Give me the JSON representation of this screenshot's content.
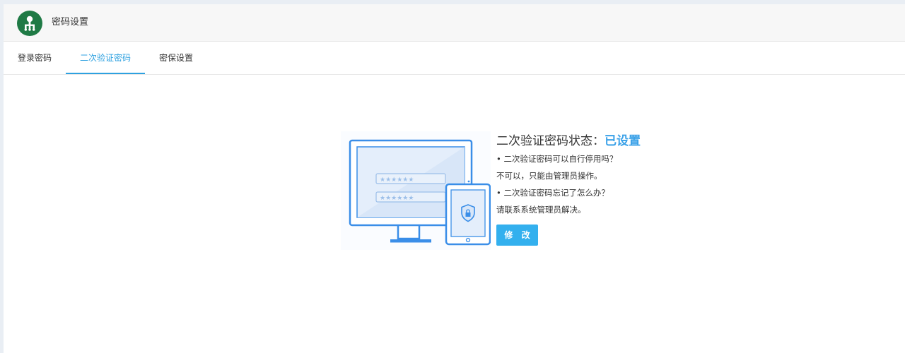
{
  "header": {
    "title": "密码设置",
    "avatar_icon": "user-tree-icon",
    "avatar_color": "#1f7a45"
  },
  "tabs": [
    {
      "label": "登录密码",
      "active": false
    },
    {
      "label": "二次验证密码",
      "active": true
    },
    {
      "label": "密保设置",
      "active": false
    }
  ],
  "main": {
    "status_label": "二次验证密码状态：",
    "status_value": "已设置",
    "faq": [
      {
        "question": "• 二次验证密码可以自行停用吗？",
        "answer": "不可以，只能由管理员操作。"
      },
      {
        "question": "• 二次验证密码忘记了怎么办？",
        "answer": "请联系系统管理员解决。"
      }
    ],
    "edit_button": "修 改",
    "illustration_icon": "monitor-tablet-lock-icon"
  },
  "colors": {
    "accent": "#2ea1e0",
    "status": "#3aa1e8",
    "button": "#33b0ee"
  }
}
